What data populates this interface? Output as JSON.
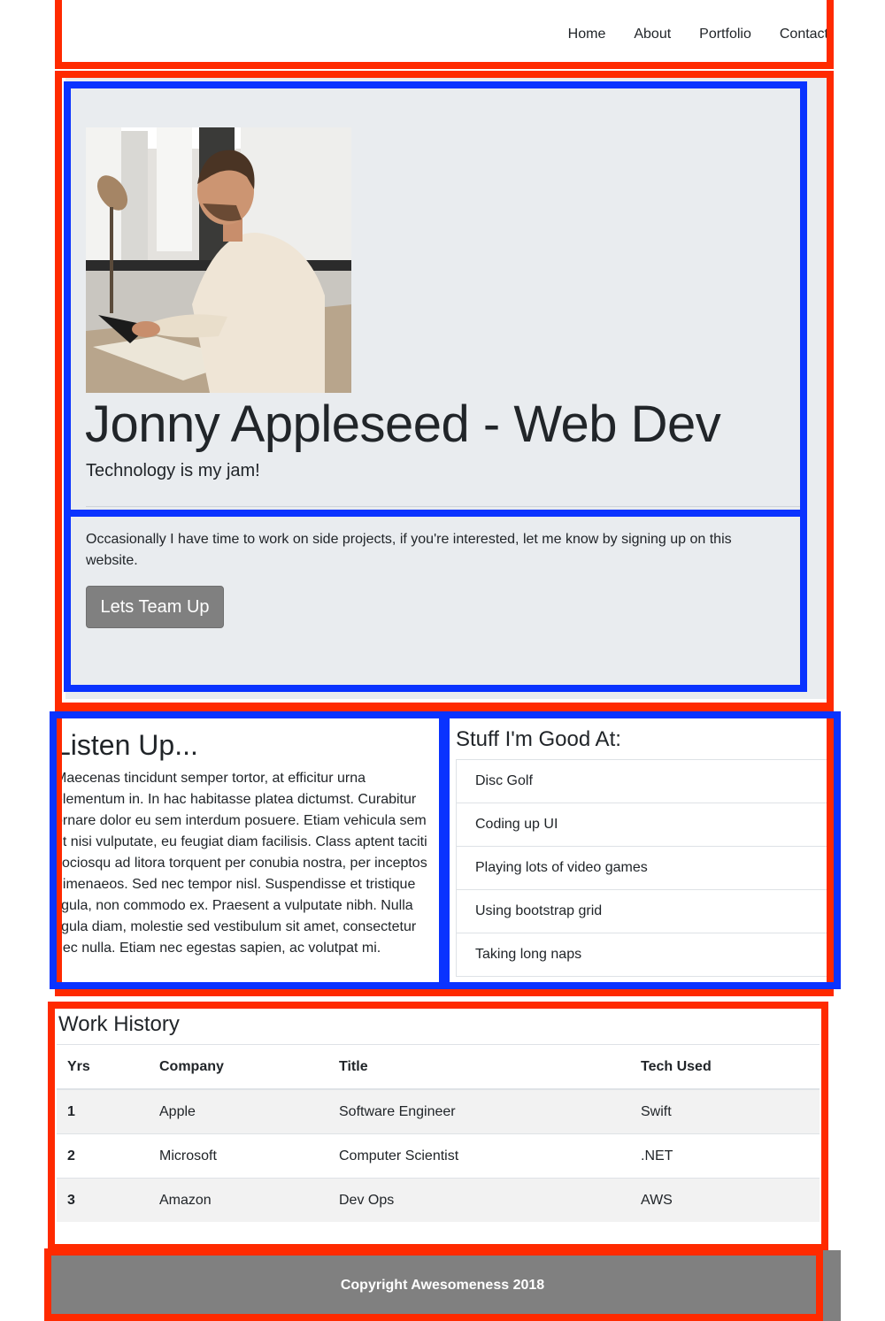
{
  "nav": {
    "items": [
      "Home",
      "About",
      "Portfolio",
      "Contact"
    ]
  },
  "hero": {
    "title": "Jonny Appleseed - Web Dev",
    "lead": "Technology is my jam!",
    "text": "Occasionally I have time to work on side projects, if you're interested, let me know by signing up on this website.",
    "button": "Lets Team Up"
  },
  "listen": {
    "heading": "Listen Up...",
    "text": "Maecenas tincidunt semper tortor, at efficitur urna elementum in. In hac habitasse platea dictumst. Curabitur ornare dolor eu sem interdum posuere. Etiam vehicula sem ut nisi vulputate, eu feugiat diam facilisis. Class aptent taciti sociosqu ad litora torquent per conubia nostra, per inceptos himenaeos. Sed nec tempor nisl. Suspendisse et tristique ligula, non commodo ex. Praesent a vulputate nibh. Nulla ligula diam, molestie sed vestibulum sit amet, consectetur nec nulla. Etiam nec egestas sapien, ac volutpat mi."
  },
  "skills": {
    "heading": "Stuff I'm Good At:",
    "items": [
      "Disc Golf",
      "Coding up UI",
      "Playing lots of video games",
      "Using bootstrap grid",
      "Taking long naps"
    ]
  },
  "work": {
    "heading": "Work History",
    "columns": [
      "Yrs",
      "Company",
      "Title",
      "Tech Used"
    ],
    "rows": [
      [
        "1",
        "Apple",
        "Software Engineer",
        "Swift"
      ],
      [
        "2",
        "Microsoft",
        "Computer Scientist",
        ".NET"
      ],
      [
        "3",
        "Amazon",
        "Dev Ops",
        "AWS"
      ]
    ]
  },
  "footer": {
    "text": "Copyright Awesomeness 2018"
  },
  "colors": {
    "annotation_red": "#ff2a00",
    "annotation_blue": "#0a33ff",
    "jumbotron_bg": "#e9ecef",
    "button_gray": "#808080"
  }
}
